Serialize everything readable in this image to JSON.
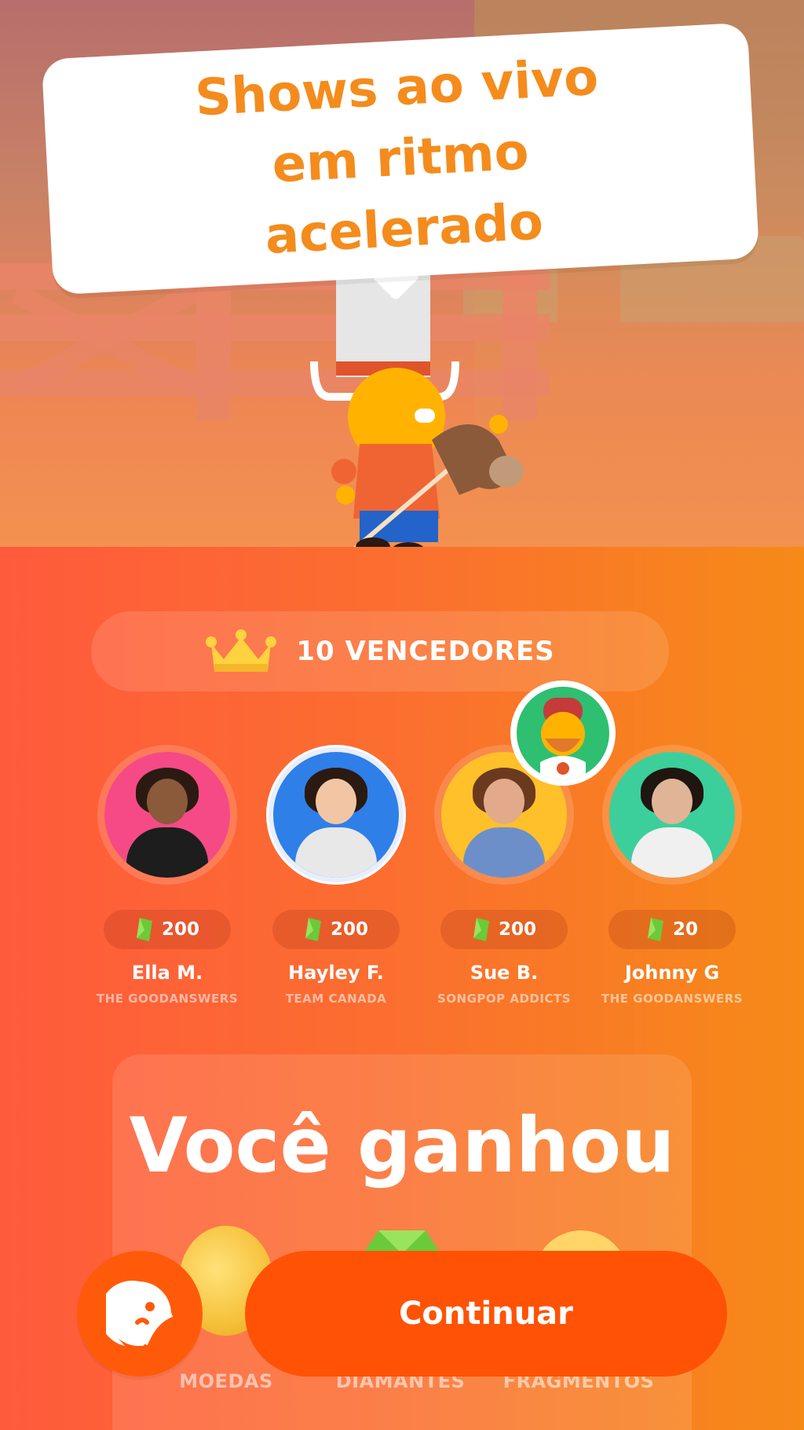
{
  "banner": {
    "headline": "Shows ao vivo em ritmo acelerado"
  },
  "winners": {
    "title": "10 VENCEDORES",
    "icon": "crown-icon",
    "list": [
      {
        "name": "Ella M.",
        "team": "THE GOODANSWERS",
        "score": "200",
        "avatar_color": "#f54a86"
      },
      {
        "name": "Hayley F.",
        "team": "TEAM CANADA",
        "score": "200",
        "avatar_color": "#2f7fe8"
      },
      {
        "name": "Sue B.",
        "team": "SONGPOP ADDICTS",
        "score": "200",
        "avatar_color": "#ffc02a"
      },
      {
        "name": "Johnny G",
        "team": "THE GOODANSWERS",
        "score": "20",
        "avatar_color": "#3ccf9b"
      }
    ]
  },
  "prize": {
    "title": "Você ganhou",
    "rewards": [
      {
        "label": "MOEDAS",
        "icon": "coin-icon"
      },
      {
        "label": "DIAMANTES",
        "icon": "diamond-icon"
      },
      {
        "label": "FRAGMENTOS",
        "icon": "fragment-icon"
      }
    ]
  },
  "actions": {
    "continue_label": "Continuar",
    "emoji_icon": "sticker-face-icon"
  },
  "colors": {
    "accent": "#ff5205",
    "banner_text": "#f48c1d",
    "gem": "#6cc93a"
  }
}
